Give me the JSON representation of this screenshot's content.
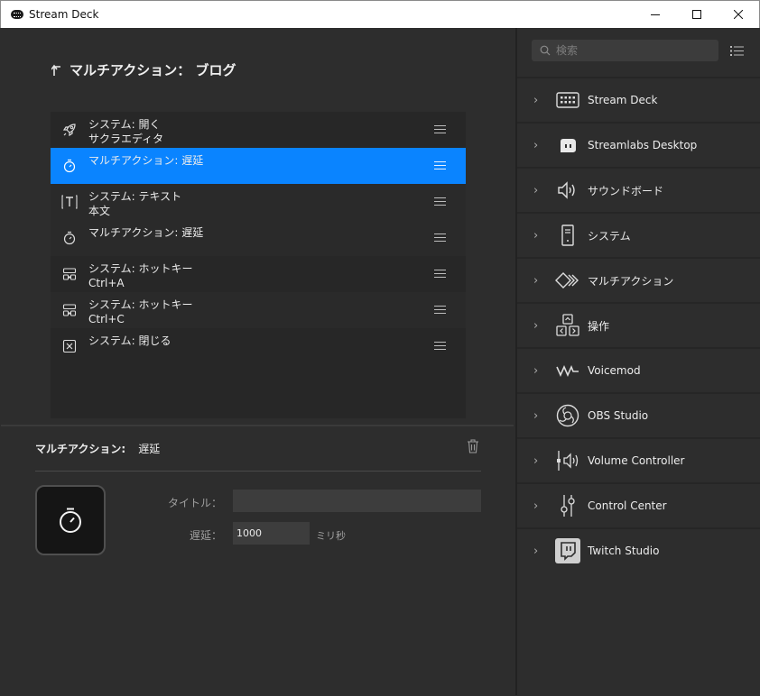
{
  "window": {
    "title": "Stream Deck"
  },
  "header": {
    "title": "マルチアクション： ブログ"
  },
  "actions": [
    {
      "line1": "システム: 開く",
      "line2": "サクラエディタ",
      "icon": "rocket-icon"
    },
    {
      "line1": "マルチアクション: 遅延",
      "line2": "",
      "icon": "stopwatch-icon",
      "selected": true
    },
    {
      "line1": "システム: テキスト",
      "line2": "本文",
      "icon": "text-icon"
    },
    {
      "line1": "マルチアクション: 遅延",
      "line2": "",
      "icon": "stopwatch-icon"
    },
    {
      "line1": "システム: ホットキー",
      "line2": "Ctrl+A",
      "icon": "hotkey-icon"
    },
    {
      "line1": "システム: ホットキー",
      "line2": "Ctrl+C",
      "icon": "hotkey-icon"
    },
    {
      "line1": "システム: 閉じる",
      "line2": "",
      "icon": "close-app-icon"
    }
  ],
  "inspector": {
    "category": "マルチアクション:",
    "action": "遅延",
    "title_label": "タイトル：",
    "title_value": "",
    "delay_label": "遅延：",
    "delay_value": "1000",
    "delay_unit": "ミリ秒"
  },
  "search": {
    "placeholder": "検索"
  },
  "categories": [
    {
      "label": "Stream Deck",
      "icon": "stream-deck-icon"
    },
    {
      "label": "Streamlabs Desktop",
      "icon": "streamlabs-icon"
    },
    {
      "label": "サウンドボード",
      "icon": "speaker-icon"
    },
    {
      "label": "システム",
      "icon": "computer-icon"
    },
    {
      "label": "マルチアクション",
      "icon": "multi-action-icon"
    },
    {
      "label": "操作",
      "icon": "navigation-icon"
    },
    {
      "label": "Voicemod",
      "icon": "voicemod-icon"
    },
    {
      "label": "OBS Studio",
      "icon": "obs-icon"
    },
    {
      "label": "Volume Controller",
      "icon": "volume-controller-icon"
    },
    {
      "label": "Control Center",
      "icon": "sliders-icon"
    },
    {
      "label": "Twitch Studio",
      "icon": "twitch-icon"
    }
  ],
  "colors": {
    "accent": "#0a84ff",
    "background": "#2d2d2d",
    "list": "#272727"
  }
}
